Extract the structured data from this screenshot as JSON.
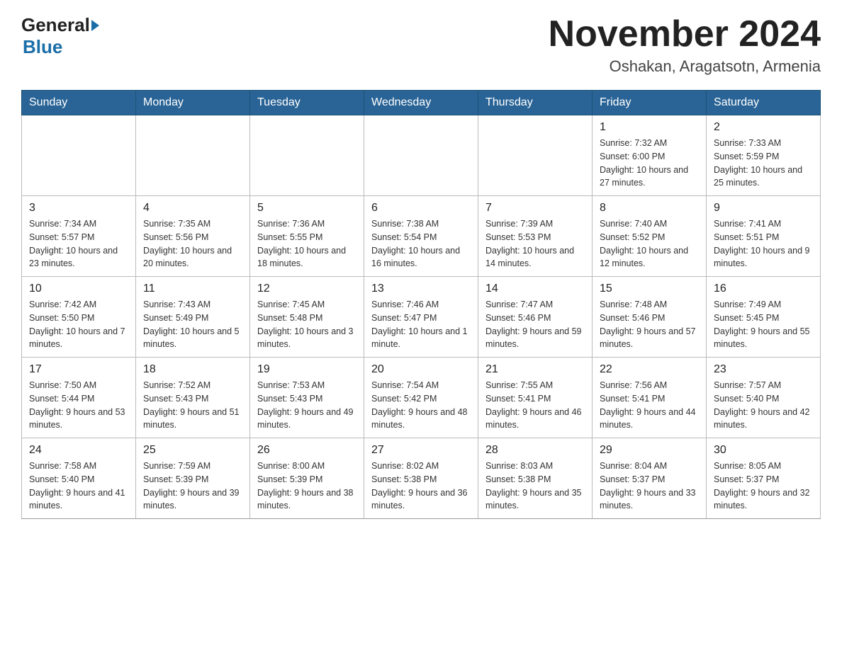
{
  "header": {
    "logo_general": "General",
    "logo_blue": "Blue",
    "month_title": "November 2024",
    "location": "Oshakan, Aragatsotn, Armenia"
  },
  "calendar": {
    "days_of_week": [
      "Sunday",
      "Monday",
      "Tuesday",
      "Wednesday",
      "Thursday",
      "Friday",
      "Saturday"
    ],
    "weeks": [
      [
        {
          "day": "",
          "info": ""
        },
        {
          "day": "",
          "info": ""
        },
        {
          "day": "",
          "info": ""
        },
        {
          "day": "",
          "info": ""
        },
        {
          "day": "",
          "info": ""
        },
        {
          "day": "1",
          "info": "Sunrise: 7:32 AM\nSunset: 6:00 PM\nDaylight: 10 hours and 27 minutes."
        },
        {
          "day": "2",
          "info": "Sunrise: 7:33 AM\nSunset: 5:59 PM\nDaylight: 10 hours and 25 minutes."
        }
      ],
      [
        {
          "day": "3",
          "info": "Sunrise: 7:34 AM\nSunset: 5:57 PM\nDaylight: 10 hours and 23 minutes."
        },
        {
          "day": "4",
          "info": "Sunrise: 7:35 AM\nSunset: 5:56 PM\nDaylight: 10 hours and 20 minutes."
        },
        {
          "day": "5",
          "info": "Sunrise: 7:36 AM\nSunset: 5:55 PM\nDaylight: 10 hours and 18 minutes."
        },
        {
          "day": "6",
          "info": "Sunrise: 7:38 AM\nSunset: 5:54 PM\nDaylight: 10 hours and 16 minutes."
        },
        {
          "day": "7",
          "info": "Sunrise: 7:39 AM\nSunset: 5:53 PM\nDaylight: 10 hours and 14 minutes."
        },
        {
          "day": "8",
          "info": "Sunrise: 7:40 AM\nSunset: 5:52 PM\nDaylight: 10 hours and 12 minutes."
        },
        {
          "day": "9",
          "info": "Sunrise: 7:41 AM\nSunset: 5:51 PM\nDaylight: 10 hours and 9 minutes."
        }
      ],
      [
        {
          "day": "10",
          "info": "Sunrise: 7:42 AM\nSunset: 5:50 PM\nDaylight: 10 hours and 7 minutes."
        },
        {
          "day": "11",
          "info": "Sunrise: 7:43 AM\nSunset: 5:49 PM\nDaylight: 10 hours and 5 minutes."
        },
        {
          "day": "12",
          "info": "Sunrise: 7:45 AM\nSunset: 5:48 PM\nDaylight: 10 hours and 3 minutes."
        },
        {
          "day": "13",
          "info": "Sunrise: 7:46 AM\nSunset: 5:47 PM\nDaylight: 10 hours and 1 minute."
        },
        {
          "day": "14",
          "info": "Sunrise: 7:47 AM\nSunset: 5:46 PM\nDaylight: 9 hours and 59 minutes."
        },
        {
          "day": "15",
          "info": "Sunrise: 7:48 AM\nSunset: 5:46 PM\nDaylight: 9 hours and 57 minutes."
        },
        {
          "day": "16",
          "info": "Sunrise: 7:49 AM\nSunset: 5:45 PM\nDaylight: 9 hours and 55 minutes."
        }
      ],
      [
        {
          "day": "17",
          "info": "Sunrise: 7:50 AM\nSunset: 5:44 PM\nDaylight: 9 hours and 53 minutes."
        },
        {
          "day": "18",
          "info": "Sunrise: 7:52 AM\nSunset: 5:43 PM\nDaylight: 9 hours and 51 minutes."
        },
        {
          "day": "19",
          "info": "Sunrise: 7:53 AM\nSunset: 5:43 PM\nDaylight: 9 hours and 49 minutes."
        },
        {
          "day": "20",
          "info": "Sunrise: 7:54 AM\nSunset: 5:42 PM\nDaylight: 9 hours and 48 minutes."
        },
        {
          "day": "21",
          "info": "Sunrise: 7:55 AM\nSunset: 5:41 PM\nDaylight: 9 hours and 46 minutes."
        },
        {
          "day": "22",
          "info": "Sunrise: 7:56 AM\nSunset: 5:41 PM\nDaylight: 9 hours and 44 minutes."
        },
        {
          "day": "23",
          "info": "Sunrise: 7:57 AM\nSunset: 5:40 PM\nDaylight: 9 hours and 42 minutes."
        }
      ],
      [
        {
          "day": "24",
          "info": "Sunrise: 7:58 AM\nSunset: 5:40 PM\nDaylight: 9 hours and 41 minutes."
        },
        {
          "day": "25",
          "info": "Sunrise: 7:59 AM\nSunset: 5:39 PM\nDaylight: 9 hours and 39 minutes."
        },
        {
          "day": "26",
          "info": "Sunrise: 8:00 AM\nSunset: 5:39 PM\nDaylight: 9 hours and 38 minutes."
        },
        {
          "day": "27",
          "info": "Sunrise: 8:02 AM\nSunset: 5:38 PM\nDaylight: 9 hours and 36 minutes."
        },
        {
          "day": "28",
          "info": "Sunrise: 8:03 AM\nSunset: 5:38 PM\nDaylight: 9 hours and 35 minutes."
        },
        {
          "day": "29",
          "info": "Sunrise: 8:04 AM\nSunset: 5:37 PM\nDaylight: 9 hours and 33 minutes."
        },
        {
          "day": "30",
          "info": "Sunrise: 8:05 AM\nSunset: 5:37 PM\nDaylight: 9 hours and 32 minutes."
        }
      ]
    ]
  }
}
